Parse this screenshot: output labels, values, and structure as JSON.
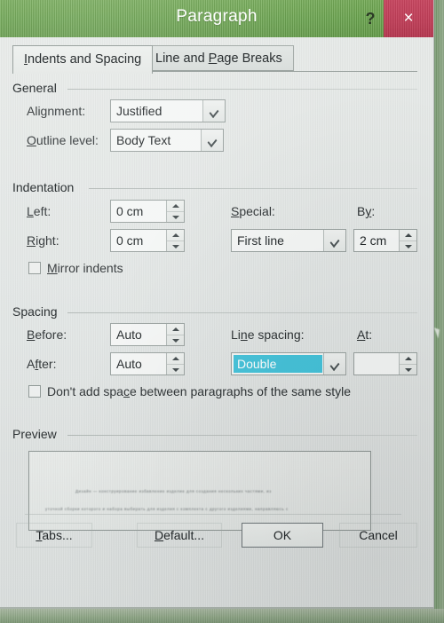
{
  "window": {
    "title": "Paragraph",
    "help_label": "?",
    "close_label": "×",
    "titlebar_color": "#6aa44e",
    "close_color": "#bf3d57"
  },
  "tabs": [
    {
      "label_pre": "I",
      "label_post": "ndents and Spacing",
      "active": true
    },
    {
      "label_pre": "P",
      "label_post": "age Breaks",
      "active": false
    }
  ],
  "tab_labels": {
    "active_full": "Indents and Spacing",
    "inactive_full": "Line and Page Breaks"
  },
  "general": {
    "title": "General",
    "alignment": {
      "label": "Alignment:",
      "value": "Justified"
    },
    "outline_level": {
      "label": "Outline level:",
      "value": "Body Text"
    }
  },
  "indentation": {
    "title": "Indentation",
    "left": {
      "label": "Left:",
      "value": "0 cm"
    },
    "right": {
      "label": "Right:",
      "value": "0 cm"
    },
    "special": {
      "label": "Special:",
      "value": "First line"
    },
    "by": {
      "label": "By:",
      "value": "2 cm"
    },
    "mirror_indents": {
      "label": "Mirror indents",
      "checked": false
    }
  },
  "spacing": {
    "title": "Spacing",
    "before": {
      "label": "Before:",
      "value": "Auto"
    },
    "after": {
      "label": "After:",
      "value": "Auto"
    },
    "line_spacing": {
      "label": "Line spacing:",
      "value": "Double",
      "selected": true,
      "highlight_color": "#46c3da"
    },
    "at": {
      "label": "At:",
      "value": ""
    },
    "dont_add_space": {
      "label": "Don't add space between paragraphs of the same style",
      "checked": false
    }
  },
  "preview": {
    "title": "Preview",
    "line1": "Дизайн — конструирование избавление изделие для создания нескольких частями, из",
    "line2": "уточной сборки которого и набора выбирать для изделия с комплекта с другого изделиями, направляюсь с"
  },
  "footer": {
    "tabs_pre": "T",
    "tabs_post": "abs...",
    "default_pre": "D",
    "default_post": "efault...",
    "ok": "OK",
    "cancel": "Cancel"
  }
}
